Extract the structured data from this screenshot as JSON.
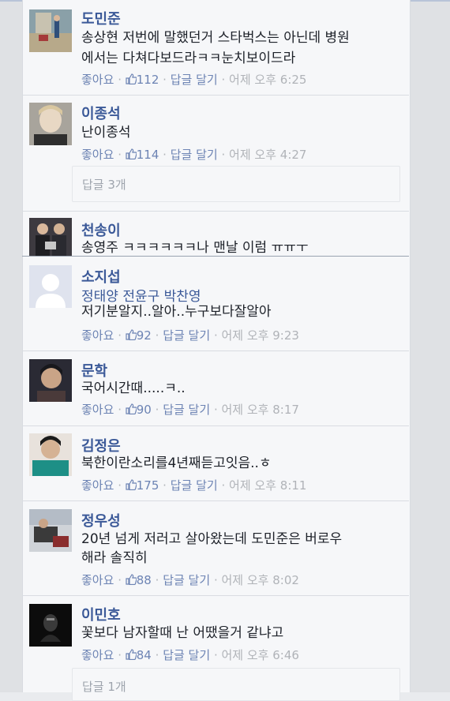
{
  "comments": [
    {
      "name": "도민준",
      "lines": [
        "송상현 저번에 말했던거 스타벅스는 아닌데 병원",
        "에서는 다쳐다보드라ㅋㅋ눈치보이드라"
      ],
      "like_label": "좋아요",
      "likes": "112",
      "reply_label": "답글 달기",
      "time": "어제 오후 6:25"
    },
    {
      "name": "이종석",
      "lines": [
        "난이종석"
      ],
      "like_label": "좋아요",
      "likes": "114",
      "reply_label": "답글 달기",
      "time": "어제 오후 4:27",
      "replies": "답글 3개"
    },
    {
      "name": "천송이",
      "lines": [
        "송영주 ㅋㅋㅋㅋㅋㅋ나 맨날 이럼 ㅠㅠㅜ"
      ]
    },
    {
      "name": "소지섭",
      "tags": "정태양 전윤구 박찬영",
      "lines": [
        "저기분알지..알아..누구보다잘알아"
      ],
      "like_label": "좋아요",
      "likes": "92",
      "reply_label": "답글 달기",
      "time": "어제 오후 9:23"
    },
    {
      "name": "문학",
      "lines": [
        "국어시간때.....ㅋ.."
      ],
      "like_label": "좋아요",
      "likes": "90",
      "reply_label": "답글 달기",
      "time": "어제 오후 8:17"
    },
    {
      "name": "김정은",
      "lines": [
        "북한이란소리를4년째듣고잇음..ㅎ"
      ],
      "like_label": "좋아요",
      "likes": "175",
      "reply_label": "답글 달기",
      "time": "어제 오후 8:11"
    },
    {
      "name": "정우성",
      "lines": [
        "20년 넘게 저러고 살아왔는데 도민준은 버로우",
        "해라 솔직히"
      ],
      "like_label": "좋아요",
      "likes": "88",
      "reply_label": "답글 달기",
      "time": "어제 오후 8:02"
    },
    {
      "name": "이민호",
      "lines": [
        "꽃보다 남자할때 난 어땠을거 같냐고"
      ],
      "like_label": "좋아요",
      "likes": "84",
      "reply_label": "답글 달기",
      "time": "어제 오후 6:46",
      "replies": "답글 1개"
    }
  ],
  "colors": {
    "name": "#3b5998",
    "link": "#6d84b4",
    "meta": "#7f7f7f"
  }
}
